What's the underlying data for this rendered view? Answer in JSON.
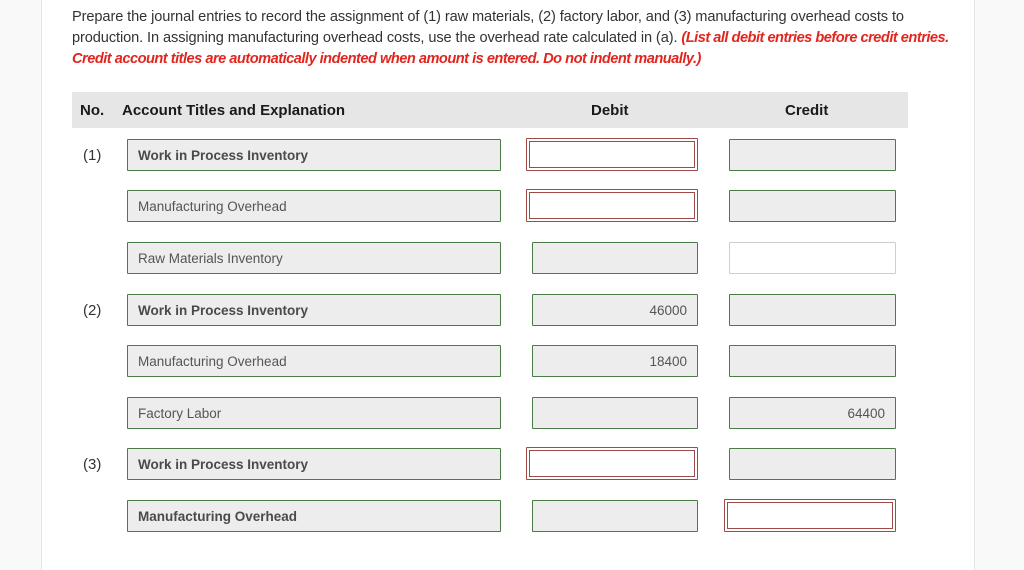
{
  "instructions": {
    "text": "Prepare the journal entries to record the assignment of (1) raw materials, (2) factory labor, and (3) manufacturing overhead costs to production. In assigning manufacturing overhead costs, use the overhead rate calculated in (a). ",
    "emphasis": "(List all debit entries before credit entries. Credit account titles are automatically indented when amount is entered. Do not indent manually.)"
  },
  "table": {
    "headers": {
      "no": "No.",
      "account": "Account Titles and Explanation",
      "debit": "Debit",
      "credit": "Credit"
    },
    "rows": [
      {
        "no": "(1)",
        "account": "Work in Process Inventory",
        "account_bold": true,
        "debit": "",
        "credit": "",
        "debit_state": "error",
        "credit_state": "correct"
      },
      {
        "no": "",
        "account": "Manufacturing Overhead",
        "account_bold": false,
        "debit": "",
        "credit": "",
        "debit_state": "error",
        "credit_state": "correct"
      },
      {
        "no": "",
        "account": "Raw Materials Inventory",
        "account_bold": false,
        "debit": "",
        "credit": "",
        "debit_state": "correct",
        "credit_state": "empty"
      },
      {
        "no": "(2)",
        "account": "Work in Process Inventory",
        "account_bold": true,
        "debit": "46000",
        "credit": "",
        "debit_state": "correct",
        "credit_state": "correct"
      },
      {
        "no": "",
        "account": "Manufacturing Overhead",
        "account_bold": false,
        "debit": "18400",
        "credit": "",
        "debit_state": "correct",
        "credit_state": "correct"
      },
      {
        "no": "",
        "account": "Factory Labor",
        "account_bold": false,
        "debit": "",
        "credit": "64400",
        "debit_state": "correct",
        "credit_state": "correct"
      },
      {
        "no": "(3)",
        "account": "Work in Process Inventory",
        "account_bold": true,
        "debit": "",
        "credit": "",
        "debit_state": "error",
        "credit_state": "correct"
      },
      {
        "no": "",
        "account": "Manufacturing Overhead",
        "account_bold": true,
        "debit": "",
        "credit": "",
        "debit_state": "correct",
        "credit_state": "error"
      }
    ]
  },
  "colors": {
    "correct_border": "#4b7b47",
    "error_border": "#a04a48",
    "emphasis_text": "#e0261f",
    "header_bg": "#e6e6e6"
  }
}
